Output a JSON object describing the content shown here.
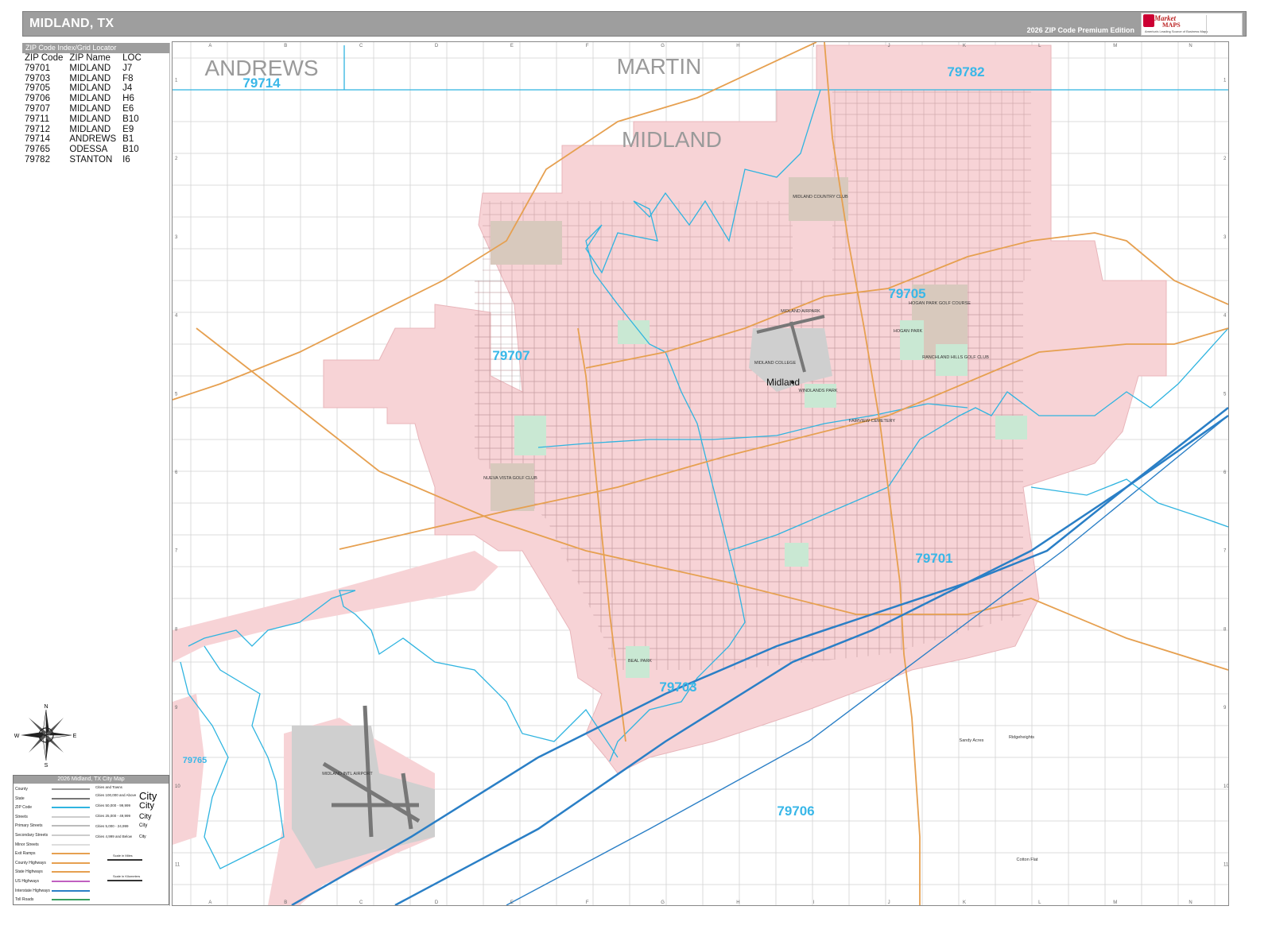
{
  "header": {
    "title": "MIDLAND, TX",
    "edition": "2026 ZIP Code Premium Edition",
    "logo_text": "Market",
    "logo_text2": "MAPS",
    "logo_tagline": "America's Leading Source of Business Maps"
  },
  "zip_index": {
    "heading": "ZIP Code Index/Grid Locator",
    "columns": [
      "ZIP Code",
      "ZIP Name",
      "LOC"
    ],
    "rows": [
      [
        "79701",
        "MIDLAND",
        "J7"
      ],
      [
        "79703",
        "MIDLAND",
        "F8"
      ],
      [
        "79705",
        "MIDLAND",
        "J4"
      ],
      [
        "79706",
        "MIDLAND",
        "H6"
      ],
      [
        "79707",
        "MIDLAND",
        "E6"
      ],
      [
        "79711",
        "MIDLAND",
        "B10"
      ],
      [
        "79712",
        "MIDLAND",
        "E9"
      ],
      [
        "79714",
        "ANDREWS",
        "B1"
      ],
      [
        "79765",
        "ODESSA",
        "B10"
      ],
      [
        "79782",
        "STANTON",
        "I6"
      ]
    ]
  },
  "compass": {
    "n": "N",
    "s": "S",
    "e": "E",
    "w": "W"
  },
  "legend": {
    "title": "2026 Midland, TX City Map",
    "rows": [
      "County",
      "State",
      "ZIP Code",
      "Streets",
      "Primary Streets",
      "Secondary Streets",
      "Minor Streets",
      "Exit Ramps",
      "County Highways",
      "State Highways",
      "US Highways",
      "Interstate Highways",
      "Toll Roads"
    ],
    "cities_header": "Cities and Towns",
    "cities": [
      "Cities 100,000 and Above",
      "Cities 50,000 - 99,999",
      "Cities 25,000 - 49,999",
      "Cities 5,000 - 24,999",
      "Cities 4,999 and Below"
    ],
    "city_word": "City",
    "scale_miles": "Scale in Miles",
    "scale_km": "Scale in Kilometers"
  },
  "map": {
    "counties": [
      {
        "name": "ANDREWS"
      },
      {
        "name": "MARTIN"
      },
      {
        "name": "MIDLAND"
      }
    ],
    "zips": [
      {
        "code": "79714"
      },
      {
        "code": "79782"
      },
      {
        "code": "79705"
      },
      {
        "code": "79707"
      },
      {
        "code": "79701"
      },
      {
        "code": "79703"
      },
      {
        "code": "79765"
      },
      {
        "code": "79706"
      }
    ],
    "city": "Midland",
    "places": [
      {
        "name": "MIDLAND COUNTRY CLUB"
      },
      {
        "name": "MIDLAND AIRPARK"
      },
      {
        "name": "MIDLAND COLLEGE"
      },
      {
        "name": "WINDLANDS PARK"
      },
      {
        "name": "HOGAN PARK GOLF COURSE"
      },
      {
        "name": "HOGAN PARK"
      },
      {
        "name": "RANCHLAND HILLS GOLF CLUB"
      },
      {
        "name": "NUEVA VISTA GOLF CLUB"
      },
      {
        "name": "FAIRVIEW CEMETERY"
      },
      {
        "name": "BEAL PARK"
      },
      {
        "name": "MIDLAND INTL AIRPORT"
      },
      {
        "name": "Sandy Acres"
      },
      {
        "name": "Ridgeheights"
      },
      {
        "name": "Cotton Flat"
      }
    ],
    "grid_cols": [
      "A",
      "B",
      "C",
      "D",
      "E",
      "F",
      "G",
      "H",
      "I",
      "J",
      "K",
      "L",
      "M",
      "N"
    ],
    "grid_rows": [
      "1",
      "2",
      "3",
      "4",
      "5",
      "6",
      "7",
      "8",
      "9",
      "10",
      "11"
    ],
    "colors": {
      "city_fill": "#f7d3d6",
      "zip_line": "#2fb4e0",
      "zip_label": "#39b7e8",
      "county_label": "#9a9a9a",
      "interstate": "#2a7fc6",
      "highway": "#e6a050",
      "street": "#8c8c8c",
      "park": "#c9e8d3",
      "golf": "#d8c9bd"
    }
  }
}
